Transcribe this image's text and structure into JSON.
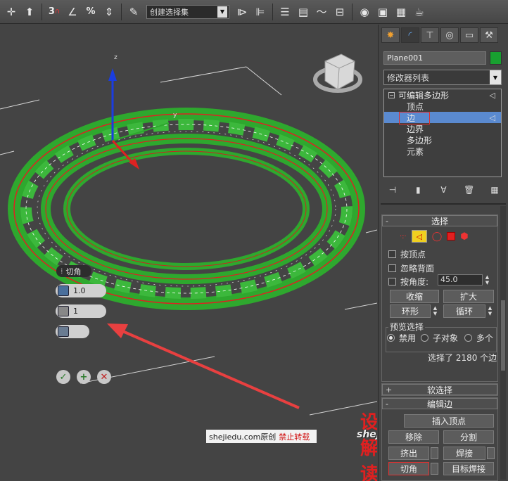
{
  "toolbar": {
    "snap_labels": [
      "3",
      "%"
    ],
    "selection_set": "创建选择集"
  },
  "viewport": {
    "gizmo_axis_z": "z",
    "gizmo_axis_y": "y",
    "caddy": {
      "title": "切角",
      "amount": "1.0",
      "segments": "1",
      "ok_symbol": "✓",
      "apply_symbol": "+",
      "cancel_symbol": "✕"
    }
  },
  "watermark": {
    "site": "shejiedu.com原创",
    "warning": "禁止转载",
    "logo_cn": "设解读",
    "logo_en": "shejiedu.com"
  },
  "panel": {
    "object_name": "Plane001",
    "object_color": "#18a030",
    "modifier_list": "修改器列表",
    "stack": {
      "root": "可编辑多边形",
      "items": [
        "顶点",
        "边",
        "边界",
        "多边形",
        "元素"
      ],
      "selected": "边"
    },
    "selection": {
      "title": "选择",
      "by_vertex": "按顶点",
      "ignore_backfacing": "忽略背面",
      "by_angle": "按角度:",
      "angle_value": "45.0",
      "shrink": "收缩",
      "grow": "扩大",
      "ring": "环形",
      "loop": "循环",
      "preview_title": "预览选择",
      "preview_options": [
        "禁用",
        "子对象",
        "多个"
      ],
      "status": "选择了 2180 个边"
    },
    "soft_selection": {
      "title": "软选择"
    },
    "edit_edges": {
      "title": "编辑边",
      "insert_vertex": "插入顶点",
      "remove": "移除",
      "split": "分割",
      "extrude": "挤出",
      "weld": "焊接",
      "chamfer": "切角",
      "target_weld": "目标焊接"
    }
  }
}
